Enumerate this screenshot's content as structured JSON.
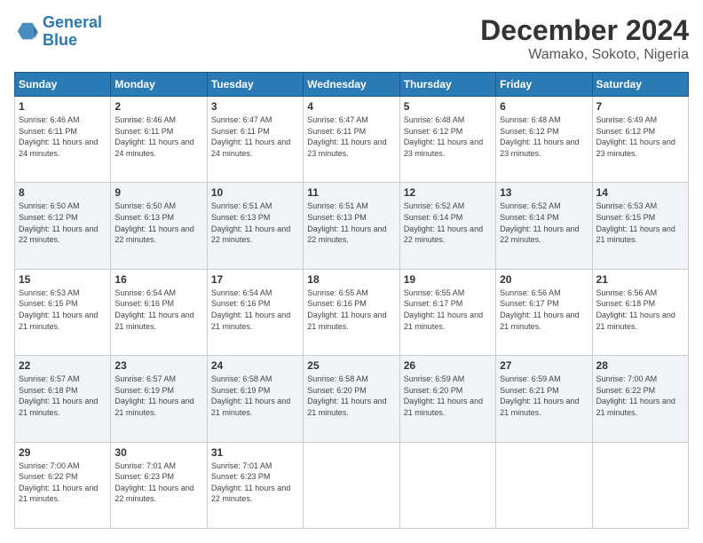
{
  "logo": {
    "line1": "General",
    "line2": "Blue"
  },
  "title": "December 2024",
  "subtitle": "Wamako, Sokoto, Nigeria",
  "days_header": [
    "Sunday",
    "Monday",
    "Tuesday",
    "Wednesday",
    "Thursday",
    "Friday",
    "Saturday"
  ],
  "weeks": [
    [
      {
        "day": "1",
        "sunrise": "6:46 AM",
        "sunset": "6:11 PM",
        "daylight": "11 hours and 24 minutes."
      },
      {
        "day": "2",
        "sunrise": "6:46 AM",
        "sunset": "6:11 PM",
        "daylight": "11 hours and 24 minutes."
      },
      {
        "day": "3",
        "sunrise": "6:47 AM",
        "sunset": "6:11 PM",
        "daylight": "11 hours and 24 minutes."
      },
      {
        "day": "4",
        "sunrise": "6:47 AM",
        "sunset": "6:11 PM",
        "daylight": "11 hours and 23 minutes."
      },
      {
        "day": "5",
        "sunrise": "6:48 AM",
        "sunset": "6:12 PM",
        "daylight": "11 hours and 23 minutes."
      },
      {
        "day": "6",
        "sunrise": "6:48 AM",
        "sunset": "6:12 PM",
        "daylight": "11 hours and 23 minutes."
      },
      {
        "day": "7",
        "sunrise": "6:49 AM",
        "sunset": "6:12 PM",
        "daylight": "11 hours and 23 minutes."
      }
    ],
    [
      {
        "day": "8",
        "sunrise": "6:50 AM",
        "sunset": "6:12 PM",
        "daylight": "11 hours and 22 minutes."
      },
      {
        "day": "9",
        "sunrise": "6:50 AM",
        "sunset": "6:13 PM",
        "daylight": "11 hours and 22 minutes."
      },
      {
        "day": "10",
        "sunrise": "6:51 AM",
        "sunset": "6:13 PM",
        "daylight": "11 hours and 22 minutes."
      },
      {
        "day": "11",
        "sunrise": "6:51 AM",
        "sunset": "6:13 PM",
        "daylight": "11 hours and 22 minutes."
      },
      {
        "day": "12",
        "sunrise": "6:52 AM",
        "sunset": "6:14 PM",
        "daylight": "11 hours and 22 minutes."
      },
      {
        "day": "13",
        "sunrise": "6:52 AM",
        "sunset": "6:14 PM",
        "daylight": "11 hours and 22 minutes."
      },
      {
        "day": "14",
        "sunrise": "6:53 AM",
        "sunset": "6:15 PM",
        "daylight": "11 hours and 21 minutes."
      }
    ],
    [
      {
        "day": "15",
        "sunrise": "6:53 AM",
        "sunset": "6:15 PM",
        "daylight": "11 hours and 21 minutes."
      },
      {
        "day": "16",
        "sunrise": "6:54 AM",
        "sunset": "6:16 PM",
        "daylight": "11 hours and 21 minutes."
      },
      {
        "day": "17",
        "sunrise": "6:54 AM",
        "sunset": "6:16 PM",
        "daylight": "11 hours and 21 minutes."
      },
      {
        "day": "18",
        "sunrise": "6:55 AM",
        "sunset": "6:16 PM",
        "daylight": "11 hours and 21 minutes."
      },
      {
        "day": "19",
        "sunrise": "6:55 AM",
        "sunset": "6:17 PM",
        "daylight": "11 hours and 21 minutes."
      },
      {
        "day": "20",
        "sunrise": "6:56 AM",
        "sunset": "6:17 PM",
        "daylight": "11 hours and 21 minutes."
      },
      {
        "day": "21",
        "sunrise": "6:56 AM",
        "sunset": "6:18 PM",
        "daylight": "11 hours and 21 minutes."
      }
    ],
    [
      {
        "day": "22",
        "sunrise": "6:57 AM",
        "sunset": "6:18 PM",
        "daylight": "11 hours and 21 minutes."
      },
      {
        "day": "23",
        "sunrise": "6:57 AM",
        "sunset": "6:19 PM",
        "daylight": "11 hours and 21 minutes."
      },
      {
        "day": "24",
        "sunrise": "6:58 AM",
        "sunset": "6:19 PM",
        "daylight": "11 hours and 21 minutes."
      },
      {
        "day": "25",
        "sunrise": "6:58 AM",
        "sunset": "6:20 PM",
        "daylight": "11 hours and 21 minutes."
      },
      {
        "day": "26",
        "sunrise": "6:59 AM",
        "sunset": "6:20 PM",
        "daylight": "11 hours and 21 minutes."
      },
      {
        "day": "27",
        "sunrise": "6:59 AM",
        "sunset": "6:21 PM",
        "daylight": "11 hours and 21 minutes."
      },
      {
        "day": "28",
        "sunrise": "7:00 AM",
        "sunset": "6:22 PM",
        "daylight": "11 hours and 21 minutes."
      }
    ],
    [
      {
        "day": "29",
        "sunrise": "7:00 AM",
        "sunset": "6:22 PM",
        "daylight": "11 hours and 21 minutes."
      },
      {
        "day": "30",
        "sunrise": "7:01 AM",
        "sunset": "6:23 PM",
        "daylight": "11 hours and 22 minutes."
      },
      {
        "day": "31",
        "sunrise": "7:01 AM",
        "sunset": "6:23 PM",
        "daylight": "11 hours and 22 minutes."
      },
      null,
      null,
      null,
      null
    ]
  ],
  "labels": {
    "sunrise": "Sunrise: ",
    "sunset": "Sunset: ",
    "daylight": "Daylight: "
  }
}
